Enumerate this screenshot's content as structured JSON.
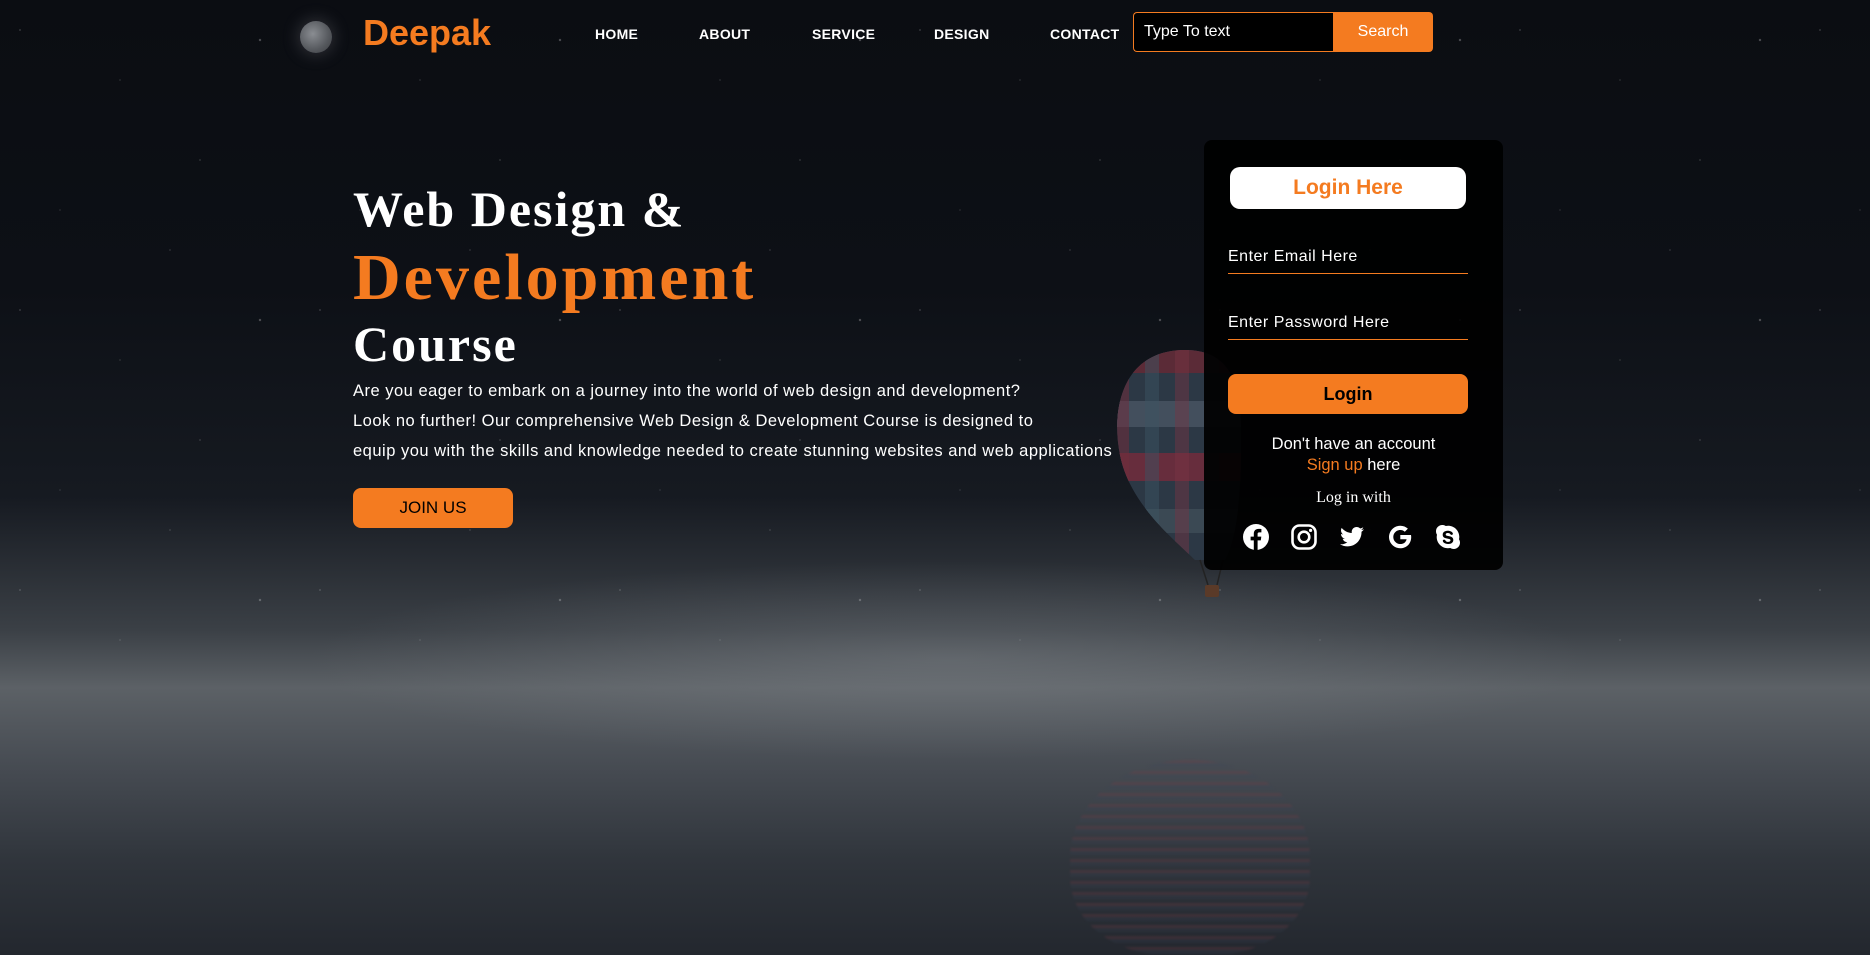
{
  "brand": {
    "name": "Deepak"
  },
  "nav": {
    "items": [
      {
        "label": "HOME"
      },
      {
        "label": "ABOUT"
      },
      {
        "label": "SERVICE"
      },
      {
        "label": "DESIGN"
      },
      {
        "label": "CONTACT"
      }
    ]
  },
  "search": {
    "placeholder": "Type To text",
    "button": "Search"
  },
  "hero": {
    "line1": "Web Design &",
    "line2": "Development",
    "line3": "Course",
    "desc": [
      "Are you eager to embark on a journey into the world of web design and development?",
      "Look no further! Our comprehensive Web Design & Development Course is designed to",
      "equip you with the skills and knowledge needed to create stunning websites and web applications"
    ],
    "cta": "JOIN US"
  },
  "login": {
    "title": "Login Here",
    "email_placeholder": "Enter Email Here",
    "password_placeholder": "Enter Password Here",
    "button": "Login",
    "no_account": "Don't have an account",
    "signup_link": "Sign up",
    "signup_suffix": " here",
    "login_with": "Log in with",
    "socials": [
      "facebook-icon",
      "instagram-icon",
      "twitter-icon",
      "google-icon",
      "skype-icon"
    ]
  },
  "colors": {
    "accent": "#f47b20",
    "card": "#000000",
    "text": "#ffffff"
  }
}
